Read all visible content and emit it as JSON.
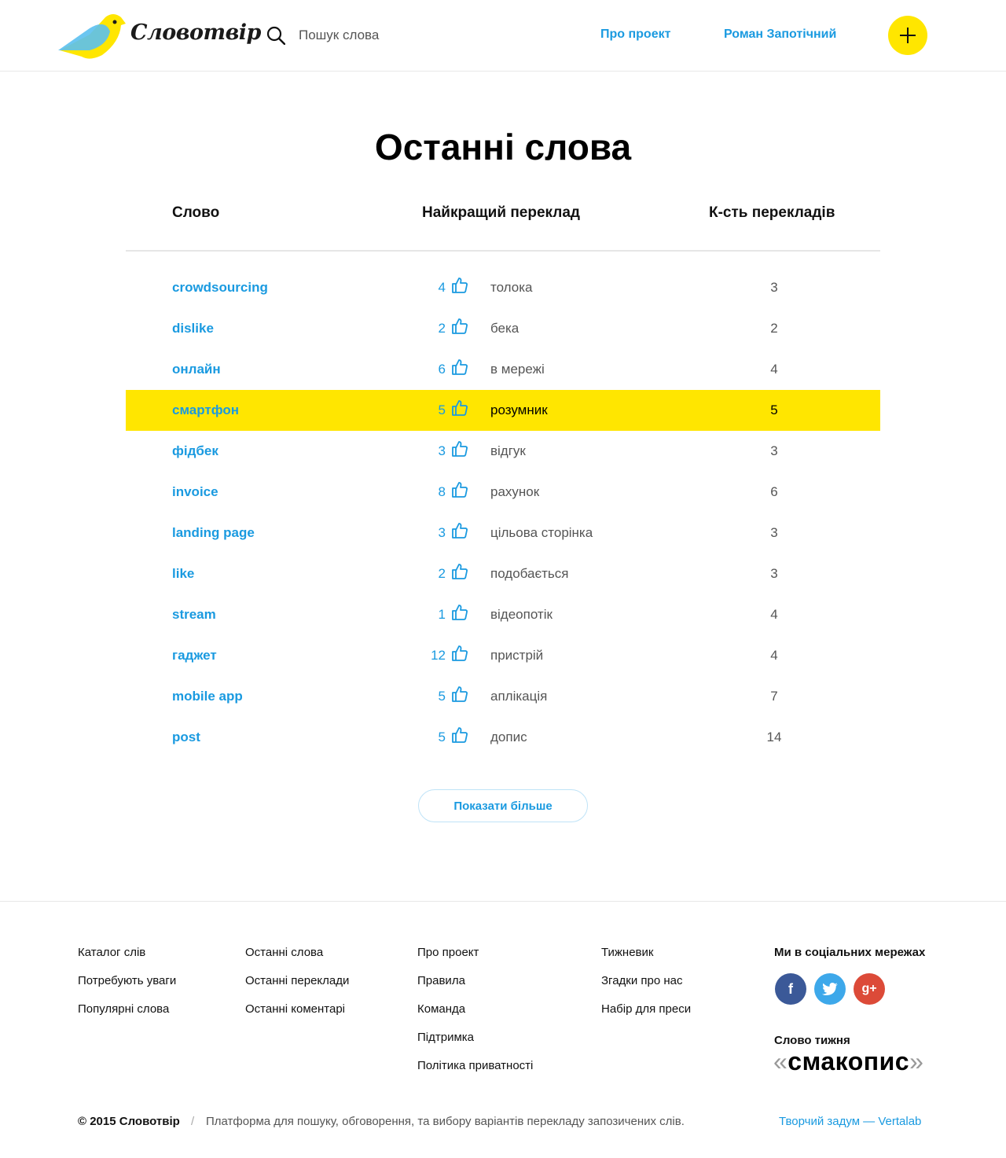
{
  "header": {
    "logo_text": "Словотвір",
    "search_placeholder": "Пошук слова",
    "nav_about": "Про проект",
    "nav_user": "Роман Запотічний",
    "add_icon": "plus-icon",
    "colors": {
      "accent_blue": "#1a9ae0",
      "accent_yellow": "#ffe600"
    }
  },
  "main": {
    "title": "Останні слова",
    "columns": {
      "word": "Слово",
      "best": "Найкращий переклад",
      "count": "К-сть перекладів"
    },
    "rows": [
      {
        "word": "crowdsourcing",
        "votes": "4",
        "translation": "толока",
        "count": "3",
        "highlighted": false
      },
      {
        "word": "dislike",
        "votes": "2",
        "translation": "бека",
        "count": "2",
        "highlighted": false
      },
      {
        "word": "онлайн",
        "votes": "6",
        "translation": "в мережі",
        "count": "4",
        "highlighted": false
      },
      {
        "word": "смартфон",
        "votes": "5",
        "translation": "розумник",
        "count": "5",
        "highlighted": true
      },
      {
        "word": "фідбек",
        "votes": "3",
        "translation": "відгук",
        "count": "3",
        "highlighted": false
      },
      {
        "word": "invoice",
        "votes": "8",
        "translation": "рахунок",
        "count": "6",
        "highlighted": false
      },
      {
        "word": "landing page",
        "votes": "3",
        "translation": "цільова сторінка",
        "count": "3",
        "highlighted": false
      },
      {
        "word": "like",
        "votes": "2",
        "translation": "подобається",
        "count": "3",
        "highlighted": false
      },
      {
        "word": "stream",
        "votes": "1",
        "translation": "відеопотік",
        "count": "4",
        "highlighted": false
      },
      {
        "word": "гаджет",
        "votes": "12",
        "translation": "пристрій",
        "count": "4",
        "highlighted": false
      },
      {
        "word": "mobile app",
        "votes": "5",
        "translation": "аплікація",
        "count": "7",
        "highlighted": false
      },
      {
        "word": "post",
        "votes": "5",
        "translation": "допис",
        "count": "14",
        "highlighted": false
      }
    ],
    "show_more": "Показати більше"
  },
  "footer": {
    "col1": [
      "Каталог слів",
      "Потребують уваги",
      "Популярні слова"
    ],
    "col2": [
      "Останні слова",
      "Останні переклади",
      "Останні коментарі"
    ],
    "col3": [
      "Про проект",
      "Правила",
      "Команда",
      "Підтримка",
      "Політика приватності"
    ],
    "col4": [
      "Тижневик",
      "Згадки про нас",
      "Набір для преси"
    ],
    "social_title": "Ми в соціальних мережах",
    "social_icons": [
      "facebook-icon",
      "twitter-icon",
      "google-plus-icon"
    ],
    "social_glyphs": {
      "facebook": "f",
      "twitter": "t",
      "gplus": "g+"
    },
    "word_of_week_label": "Слово тижня",
    "word_of_week": "смакопис",
    "quote_open": "«",
    "quote_close": "»",
    "copyright": "© 2015 Словотвір",
    "separator": "/",
    "tagline": "Платформа для пошуку, обговорення, та вибору варіантів перекладу запозичених слів.",
    "credit": "Творчий задум — Vertalab"
  }
}
